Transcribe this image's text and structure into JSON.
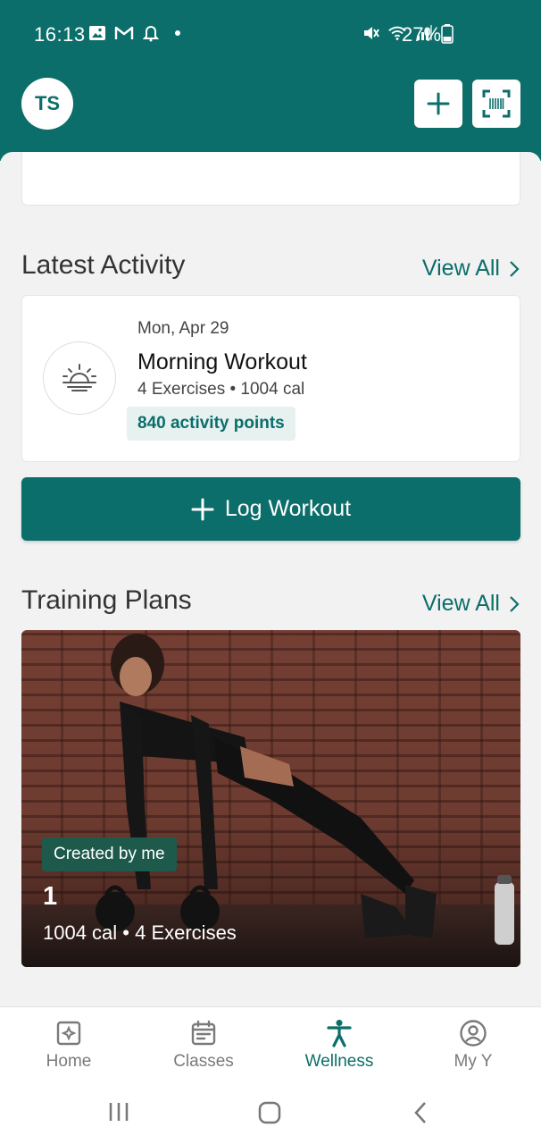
{
  "status_bar": {
    "time": "16:13",
    "battery": "27%",
    "left_icons": [
      "image-icon",
      "gmail-icon",
      "bell-icon",
      "dot-icon"
    ],
    "right_icons": [
      "mute-icon",
      "wifi-icon",
      "signal-icon",
      "battery-icon"
    ]
  },
  "header": {
    "avatar_initials": "TS",
    "add_button_icon": "plus-icon",
    "scan_button_icon": "barcode-scan-icon",
    "background_color": "#0b6e6a"
  },
  "latest_activity": {
    "title": "Latest Activity",
    "view_all": "View All",
    "card": {
      "icon": "sunrise-icon",
      "date": "Mon, Apr 29",
      "name": "Morning Workout",
      "details": "4 Exercises • 1004 cal",
      "points": "840 activity points"
    }
  },
  "log_workout": {
    "label": "Log Workout",
    "icon": "plus-icon"
  },
  "training_plans": {
    "title": "Training Plans",
    "view_all": "View All",
    "card": {
      "badge": "Created by me",
      "name": "1",
      "details": "1004 cal • 4 Exercises"
    }
  },
  "bottom_nav": {
    "items": [
      {
        "label": "Home",
        "icon": "home-icon",
        "active": false
      },
      {
        "label": "Classes",
        "icon": "calendar-icon",
        "active": false
      },
      {
        "label": "Wellness",
        "icon": "person-icon",
        "active": true
      },
      {
        "label": "My Y",
        "icon": "user-circle-icon",
        "active": false
      }
    ]
  },
  "system_nav": [
    "recents-icon",
    "home-circle-icon",
    "back-icon"
  ],
  "colors": {
    "brand": "#0b6e6a",
    "badge": "#1e5a4c",
    "points_bg": "#e6f1f0"
  }
}
